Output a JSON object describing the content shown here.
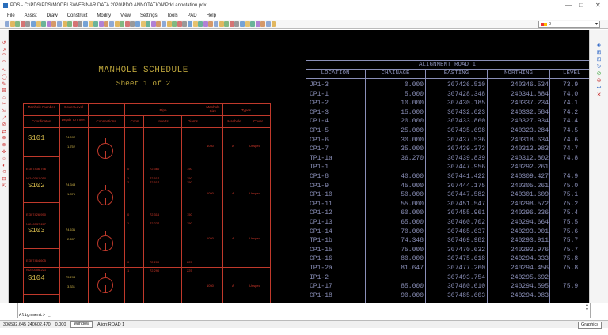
{
  "window": {
    "title": "PDS - C:\\PDS\\PDS\\MODELS\\WEBINAR DATA 2020\\PDO ANNOTATION\\Pdd annotation.pdx",
    "minimize": "—",
    "maximize": "□",
    "close": "✕"
  },
  "menu": [
    "File",
    "Assist",
    "Draw",
    "Construct",
    "Modify",
    "View",
    "Settings",
    "Tools",
    "PAD",
    "Help"
  ],
  "layer_select": {
    "value": "0"
  },
  "manhole": {
    "title": "MANHOLE SCHEDULE",
    "sheet": "Sheet 1 of 2",
    "headers": {
      "manhole_number": "Manhole Number",
      "cover_level": "Cover Level",
      "pipe": "Pipe",
      "manhole_size": "Manhole Size",
      "types": "Types",
      "coordinates": "Coordinates",
      "depth_to_invert": "Depth To Invert",
      "connections": "Connections",
      "conn": "Conn",
      "inverts": "Inverts",
      "diams": "Diams",
      "manhole": "Manhole",
      "cover": "Cover"
    },
    "rows": [
      {
        "id": "S101",
        "e": "E 307436.796",
        "n": "N 240361.050",
        "cl": "74.092",
        "depth": "1.752",
        "pipes": [
          {
            "c": "0",
            "i": "72.360",
            "d": "150"
          }
        ],
        "size": "1050",
        "mh": "A",
        "cov": "Unspec"
      },
      {
        "id": "S102",
        "e": "E 307426.950",
        "n": "N 240337.287",
        "cl": "74.343",
        "depth": "1.876",
        "pipes": [
          {
            "c": "1",
            "i": "72.517",
            "d": "150"
          },
          {
            "c": "2",
            "i": "72.517",
            "d": "150"
          },
          {
            "c": "0",
            "i": "72.316",
            "d": "150"
          }
        ],
        "size": "1050",
        "mh": "A",
        "cov": "Unspec"
      },
      {
        "id": "S103",
        "e": "E 307464.605",
        "n": "N 240306.221",
        "cl": "74.631",
        "depth": "2.287",
        "pipes": [
          {
            "c": "1",
            "i": "72.227",
            "d": "150"
          },
          {
            "c": "0",
            "i": "72.200",
            "d": "225"
          }
        ],
        "size": "1050",
        "mh": "A",
        "cov": "Unspec"
      },
      {
        "id": "S104",
        "e": "E 307461.268",
        "n": "",
        "cl": "75.298",
        "depth": "3.331",
        "pipes": [
          {
            "c": "1",
            "i": "72.290",
            "d": "225"
          }
        ],
        "size": "1050",
        "mh": "A",
        "cov": "Unspec"
      }
    ]
  },
  "alignment": {
    "title": "ALIGNMENT ROAD 1",
    "columns": [
      "LOCATION",
      "CHAINAGE",
      "EASTING",
      "NORTHING",
      "LEVEL"
    ],
    "rows": [
      [
        "JP1-3",
        "0.000",
        "307426.510",
        "240346.534",
        "73.9"
      ],
      [
        "CP1-1",
        "5.000",
        "307428.348",
        "240341.884",
        "74.0"
      ],
      [
        "CP1-2",
        "10.000",
        "307430.185",
        "240337.234",
        "74.1"
      ],
      [
        "CP1-3",
        "15.000",
        "307432.023",
        "240332.584",
        "74.2"
      ],
      [
        "CP1-4",
        "20.000",
        "307433.860",
        "240327.934",
        "74.4"
      ],
      [
        "CP1-5",
        "25.000",
        "307435.698",
        "240323.284",
        "74.5"
      ],
      [
        "CP1-6",
        "30.000",
        "307437.536",
        "240318.634",
        "74.6"
      ],
      [
        "CP1-7",
        "35.000",
        "307439.373",
        "240313.983",
        "74.7"
      ],
      [
        "TP1-1a",
        "36.270",
        "307439.839",
        "240312.802",
        "74.8"
      ],
      [
        "IP1-1",
        "",
        "307447.956",
        "240292.261",
        ""
      ],
      [
        "CP1-8",
        "40.000",
        "307441.422",
        "240309.427",
        "74.9"
      ],
      [
        "CP1-9",
        "45.000",
        "307444.175",
        "240305.261",
        "75.0"
      ],
      [
        "CP1-10",
        "50.000",
        "307447.582",
        "240301.609",
        "75.1"
      ],
      [
        "CP1-11",
        "55.000",
        "307451.547",
        "240298.572",
        "75.2"
      ],
      [
        "CP1-12",
        "60.000",
        "307455.961",
        "240296.236",
        "75.4"
      ],
      [
        "CP1-13",
        "65.000",
        "307460.702",
        "240294.664",
        "75.5"
      ],
      [
        "CP1-14",
        "70.000",
        "307465.637",
        "240293.901",
        "75.6"
      ],
      [
        "TP1-1b",
        "74.348",
        "307469.982",
        "240293.911",
        "75.7"
      ],
      [
        "CP1-15",
        "75.000",
        "307470.632",
        "240293.976",
        "75.7"
      ],
      [
        "CP1-16",
        "80.000",
        "307475.618",
        "240294.333",
        "75.8"
      ],
      [
        "TP1-2a",
        "81.647",
        "307477.260",
        "240294.456",
        "75.8"
      ],
      [
        "IP1-2",
        "",
        "307493.754",
        "240295.692",
        ""
      ],
      [
        "CP1-17",
        "85.000",
        "307480.610",
        "240294.595",
        "75.9"
      ],
      [
        "CP1-18",
        "90.000",
        "307485.603",
        "240294.983",
        ""
      ]
    ]
  },
  "command": {
    "prompt": "Alignment> _"
  },
  "status": {
    "coords": "306592.645  240602.470",
    "z": "0.000",
    "window_btn": "Window",
    "layer": "Align:ROAD 1",
    "graphics_btn": "Graphics"
  }
}
